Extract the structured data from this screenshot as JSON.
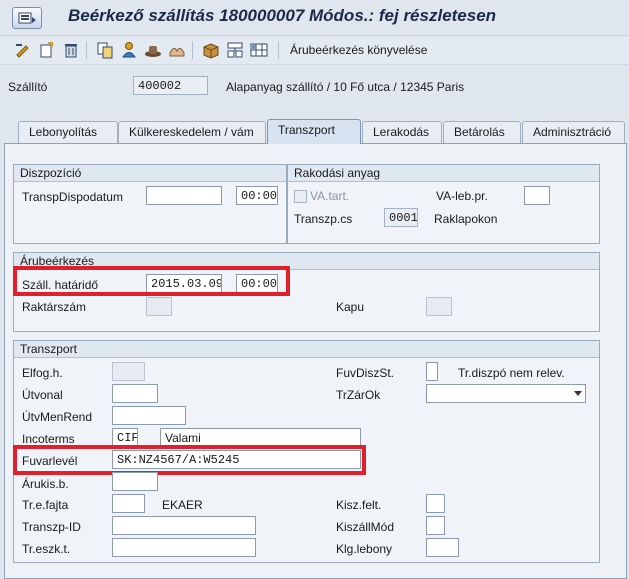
{
  "title": "Beérkező szállítás 180000007 Módos.: fej részletesen",
  "toolbar": {
    "post_label": "Árubeérkezés könyvelése"
  },
  "header": {
    "vendor_label": "Szállító",
    "vendor_value": "400002",
    "vendor_desc": "Alapanyag szállító / 10 Fő utca / 12345 Paris"
  },
  "tabs": [
    {
      "label": "Lebonyolítás"
    },
    {
      "label": "Külkereskedelem / vám"
    },
    {
      "label": "Transzport"
    },
    {
      "label": "Lerakodás"
    },
    {
      "label": "Betárolás"
    },
    {
      "label": "Adminisztráció"
    }
  ],
  "dispo": {
    "title": "Diszpozíció",
    "date_label": "TranspDispodatum",
    "date_value": "",
    "time_value": "00:00"
  },
  "loading": {
    "title": "Rakodási anyag",
    "va_tart_label": "VA.tart.",
    "va_leb_label": "VA-leb.pr.",
    "va_leb_value": "",
    "transzp_cs_label": "Transzp.cs",
    "transzp_cs_value": "0001",
    "transzp_cs_desc": "Raklapokon"
  },
  "gr": {
    "title": "Árubeérkezés",
    "deadline_label": "Száll. határidő",
    "deadline_date": "2015.03.09",
    "deadline_time": "00:00",
    "warehouse_label": "Raktárszám",
    "gate_label": "Kapu"
  },
  "transport": {
    "title": "Transzport",
    "elfog_label": "Elfog.h.",
    "utvonal_label": "Útvonal",
    "utvmenrend_label": "ÚtvMenRend",
    "incoterms_label": "Incoterms",
    "incoterms_code": "CIF",
    "incoterms_text": "Valami",
    "fuvarlevel_label": "Fuvarlevél",
    "fuvarlevel_value": "SK:NZ4567/A:W5245",
    "arukis_label": "Árukis.b.",
    "tre_fajta_label": "Tr.e.fajta",
    "ekaer_label": "EKAER",
    "transzp_id_label": "Transzp-ID",
    "tr_eszk_label": "Tr.eszk.t.",
    "fuvdiszst_label": "FuvDiszSt.",
    "tr_dispo_label": "Tr.diszpó nem relev.",
    "trzarok_label": "TrZárOk",
    "kisz_felt_label": "Kisz.felt.",
    "kiszallmod_label": "KiszállMód",
    "klg_lebony_label": "Klg.lebony"
  },
  "colors": {
    "highlight": "#e0202a",
    "title": "#1c2b45"
  }
}
